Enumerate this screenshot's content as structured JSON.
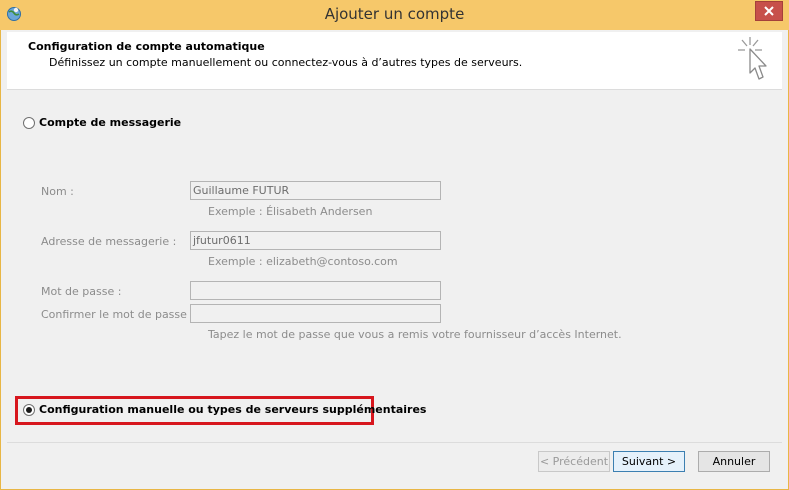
{
  "window": {
    "title": "Ajouter un compte"
  },
  "header": {
    "title": "Configuration de compte automatique",
    "subtitle": "Définissez un compte manuellement ou connectez-vous à d’autres types de serveurs."
  },
  "options": {
    "email_account": {
      "label": "Compte de messagerie",
      "selected": false
    },
    "manual": {
      "label": "Configuration manuelle ou types de serveurs supplémentaires",
      "selected": true
    }
  },
  "form": {
    "name": {
      "label": "Nom :",
      "value": "Guillaume FUTUR",
      "hint": "Exemple : Élisabeth Andersen"
    },
    "email": {
      "label": "Adresse de messagerie :",
      "value": "jfutur0611",
      "hint": "Exemple : elizabeth@contoso.com"
    },
    "password": {
      "label": "Mot de passe :",
      "value": ""
    },
    "confirm": {
      "label": "Confirmer le mot de passe :",
      "value": ""
    },
    "password_hint": "Tapez le mot de passe que vous a remis votre fournisseur d’accès Internet."
  },
  "buttons": {
    "back": "< Précédent",
    "next": "Suivant >",
    "cancel": "Annuler"
  },
  "colors": {
    "titlebar": "#f6c86a",
    "highlight": "#d7161d",
    "close": "#c7504a"
  },
  "icons": {
    "app": "outlook-globe-icon",
    "close": "close-icon",
    "header": "cursor-sparkle-icon"
  }
}
